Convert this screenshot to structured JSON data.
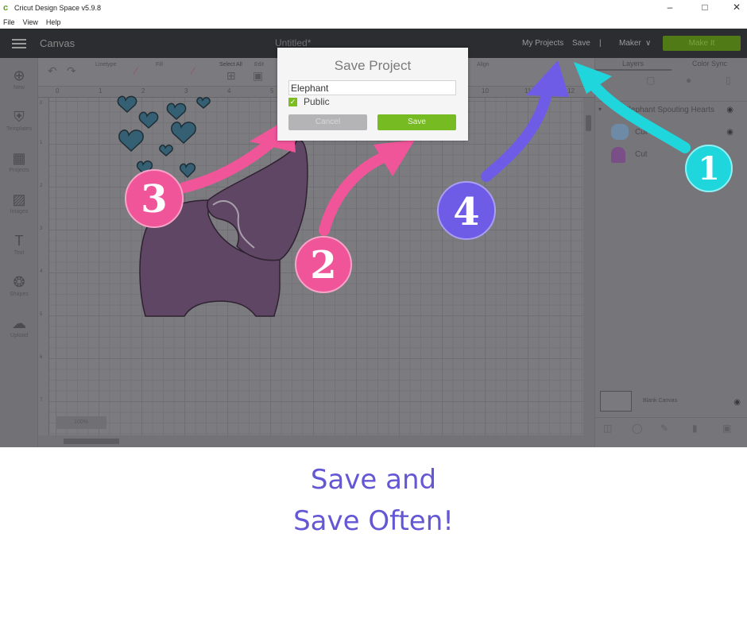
{
  "window": {
    "title": "Cricut Design Space  v5.9.8",
    "minimize_icon": "minimize-icon",
    "maximize_icon": "maximize-icon",
    "close_icon": "close-icon",
    "minimize": "–",
    "maximize": "□",
    "close": "✕"
  },
  "menubar": {
    "items": [
      "File",
      "View",
      "Help"
    ]
  },
  "appbar": {
    "section": "Canvas",
    "doc_title": "Untitled*",
    "my_projects": "My Projects",
    "save": "Save",
    "separator": "|",
    "machine": "Maker",
    "machine_chevron": "∨",
    "make_it": "Make It",
    "make_it_color": "#4f7a16"
  },
  "left_toolbar": {
    "items": [
      {
        "label": "New",
        "icon": "plus-circle-icon",
        "glyph": "⊕"
      },
      {
        "label": "Templates",
        "icon": "tshirt-icon",
        "glyph": "⛨"
      },
      {
        "label": "Projects",
        "icon": "projects-icon",
        "glyph": "▦"
      },
      {
        "label": "Images",
        "icon": "image-icon",
        "glyph": "▨"
      },
      {
        "label": "Text",
        "icon": "text-icon",
        "glyph": "T"
      },
      {
        "label": "Shapes",
        "icon": "shapes-icon",
        "glyph": "❂"
      },
      {
        "label": "Upload",
        "icon": "upload-icon",
        "glyph": "☁"
      }
    ]
  },
  "top_toolbar": {
    "undo": "↶",
    "redo": "↷",
    "linetype_label": "Linetype",
    "fill_label": "Fill",
    "select_all_label": "Select All",
    "edit_label": "Edit",
    "align_label": "Align",
    "pen_glyph": "∕",
    "select_all_glyph": "⊞",
    "edit_glyph": "▣"
  },
  "ruler": {
    "top_ticks": [
      "0",
      "1",
      "2",
      "3",
      "4",
      "5",
      "10",
      "11",
      "12"
    ],
    "left_ticks": [
      "0",
      "1",
      "2",
      "3",
      "4",
      "5",
      "6",
      "7"
    ]
  },
  "canvas": {
    "zoom_label": "100%",
    "elephant_color": "#5f4664",
    "hearts_color": "#355f72"
  },
  "save_dialog": {
    "title": "Save Project",
    "name_value": "Elephant",
    "public_label": "Public",
    "public_checked": true,
    "check_glyph": "✓",
    "cancel": "Cancel",
    "save": "Save",
    "save_color": "#76bb21"
  },
  "layers_panel": {
    "tabs": [
      "Layers",
      "Color Sync"
    ],
    "tools": [
      "Group",
      "UnGroup",
      "Duplicate",
      "Delete"
    ],
    "group_name": "Elephant Spouting Hearts",
    "layers": [
      {
        "name": "Cut",
        "type": "hearts"
      },
      {
        "name": "Cut",
        "type": "elephant"
      }
    ],
    "eye_glyph": "👁",
    "blank_canvas": "Blank Canvas",
    "bottom_tools": [
      "Slice",
      "Weld",
      "Attach",
      "Flatten",
      "Contour"
    ]
  },
  "annotations": [
    {
      "number": "1",
      "color": "#1fd6dc",
      "target": "Save"
    },
    {
      "number": "2",
      "color": "#f0559a",
      "target": "Save button"
    },
    {
      "number": "3",
      "color": "#f0559a",
      "target": "Name field"
    },
    {
      "number": "4",
      "color": "#6f5ce6",
      "target": "My Projects"
    }
  ],
  "caption": {
    "line1": "Save and",
    "line2": "Save Often!",
    "color": "#6457d6"
  }
}
